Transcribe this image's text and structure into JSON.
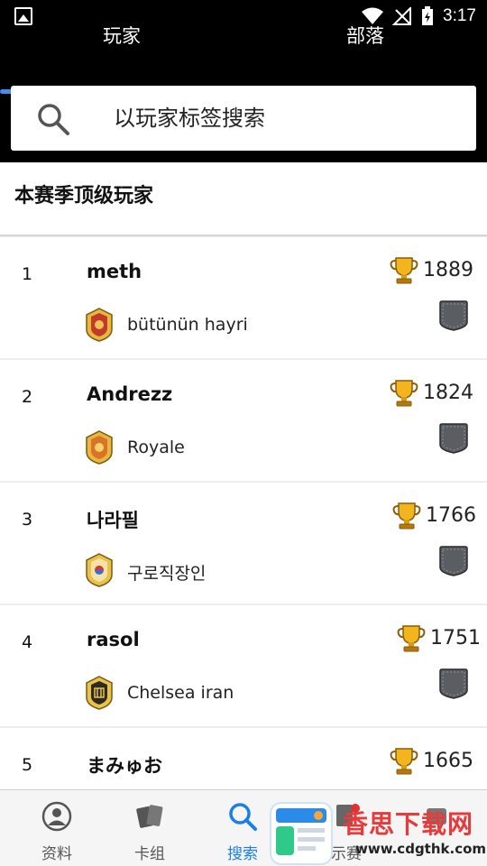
{
  "status_bar": {
    "time": "3:17"
  },
  "tabs": [
    {
      "label": "玩家"
    },
    {
      "label": "部落"
    }
  ],
  "search": {
    "placeholder": "以玩家标签搜索"
  },
  "section": {
    "title": "本赛季顶级玩家"
  },
  "players": [
    {
      "rank": "1",
      "name": "meth",
      "score": "1889",
      "clan": "bütünün hayri"
    },
    {
      "rank": "2",
      "name": "Andrezz",
      "score": "1824",
      "clan": "Royale"
    },
    {
      "rank": "3",
      "name": "나라필",
      "score": "1766",
      "clan": "구로직장인"
    },
    {
      "rank": "4",
      "name": "rasol",
      "score": "1751",
      "clan": "Chelsea iran"
    },
    {
      "rank": "5",
      "name": "まみゅお",
      "score": "1665",
      "clan": ""
    }
  ],
  "bottom_nav": [
    {
      "label": "资料",
      "icon": "profile-icon"
    },
    {
      "label": "卡组",
      "icon": "cards-icon"
    },
    {
      "label": "搜索",
      "icon": "search-icon"
    },
    {
      "label": "示赛",
      "icon": "tournament-icon"
    },
    {
      "label": "",
      "icon": "more-icon"
    }
  ],
  "watermark": {
    "title": "香思下载网",
    "url": "www.cdgthk.com"
  },
  "colors": {
    "accent": "#1a7fe8",
    "tab_indicator": "#3d8ff0",
    "watermark_red": "#e83a3a"
  }
}
